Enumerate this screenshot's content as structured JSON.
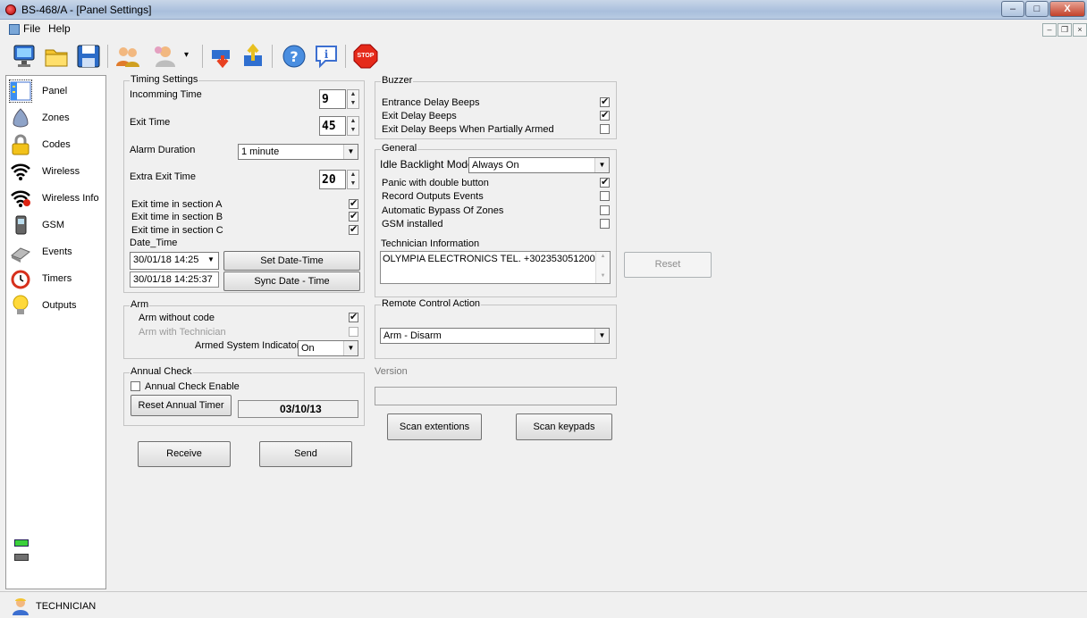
{
  "window": {
    "title": "BS-468/A - [Panel Settings]",
    "min": "–",
    "max": "□",
    "close": "X"
  },
  "menu": {
    "file": "File",
    "help": "Help",
    "mdi_min": "–",
    "mdi_restore": "❐",
    "mdi_close": "×"
  },
  "toolbar": {
    "items": [
      "monitor-icon",
      "open-folder-icon",
      "save-disk-icon",
      "users-icon",
      "user-dropdown-icon",
      "download-icon",
      "upload-icon",
      "help-icon",
      "info-icon",
      "stop-icon"
    ],
    "stop_label": "STOP",
    "dropdown_arrow": "▾"
  },
  "nav": {
    "items": [
      {
        "label": "Panel",
        "icon": "panel-icon"
      },
      {
        "label": "Zones",
        "icon": "zones-icon"
      },
      {
        "label": "Codes",
        "icon": "lock-icon"
      },
      {
        "label": "Wireless",
        "icon": "wireless-icon"
      },
      {
        "label": "Wireless Info",
        "icon": "wireless-info-icon"
      },
      {
        "label": "GSM",
        "icon": "phone-icon"
      },
      {
        "label": "Events",
        "icon": "events-icon"
      },
      {
        "label": "Timers",
        "icon": "alarm-clock-icon"
      },
      {
        "label": "Outputs",
        "icon": "bulb-icon"
      }
    ],
    "selected": "Panel"
  },
  "timing": {
    "title": "Timing Settings",
    "incoming_label": "Incomming Time",
    "incoming_value": "9",
    "exit_label": "Exit Time",
    "exit_value": "45",
    "alarm_label": "Alarm Duration",
    "alarm_value": "1 minute",
    "extra_exit_label": "Extra Exit Time",
    "extra_exit_value": "20",
    "section_a": {
      "label": "Exit time in section A",
      "checked": true
    },
    "section_b": {
      "label": "Exit time in section B",
      "checked": true
    },
    "section_c": {
      "label": "Exit time in section C",
      "checked": true
    },
    "date_time_label": "Date_Time",
    "date_picker_value": "30/01/18  14:25",
    "date_current_value": "30/01/18  14:25:37",
    "set_button": "Set Date-Time",
    "sync_button": "Sync Date - Time"
  },
  "arm": {
    "title": "Arm",
    "without_code": {
      "label": "Arm without code",
      "checked": true
    },
    "with_technician": {
      "label": "Arm with Technician",
      "checked": false
    },
    "indicators_label": "Armed System Indicators",
    "indicators_value": "On"
  },
  "annual": {
    "title": "Annual Check",
    "enable": {
      "label": "Annual Check Enable",
      "checked": false
    },
    "reset_button": "Reset Annual Timer",
    "date_value": "03/10/13"
  },
  "actions": {
    "receive": "Receive",
    "send": "Send"
  },
  "buzzer": {
    "title": "Buzzer",
    "entrance": {
      "label": "Entrance Delay Beeps",
      "checked": true
    },
    "exit": {
      "label": "Exit Delay Beeps",
      "checked": true
    },
    "partial": {
      "label": "Exit Delay Beeps When Partially Armed",
      "checked": false
    }
  },
  "general": {
    "title": "General",
    "backlight_label": "Idle Backlight Mode",
    "backlight_value": "Always On",
    "panic": {
      "label": "Panic with double button",
      "checked": true
    },
    "record": {
      "label": "Record Outputs Events",
      "checked": false
    },
    "bypass": {
      "label": "Automatic Bypass Of Zones",
      "checked": false
    },
    "gsm": {
      "label": "GSM installed",
      "checked": false
    },
    "tech_info_label": "Technician Information",
    "tech_info_value": "OLYMPIA ELECTRONICS   TEL. +302353051200"
  },
  "reset_button": "Reset",
  "remote": {
    "title": "Remote Control Action",
    "value": "Arm - Disarm"
  },
  "version": {
    "label": "Version",
    "value": ""
  },
  "scan": {
    "extensions": "Scan extentions",
    "keypads": "Scan keypads"
  },
  "status": {
    "user": "TECHNICIAN"
  },
  "colors": {
    "indicator_green": "#3bd13b",
    "indicator_gray": "#707070"
  }
}
